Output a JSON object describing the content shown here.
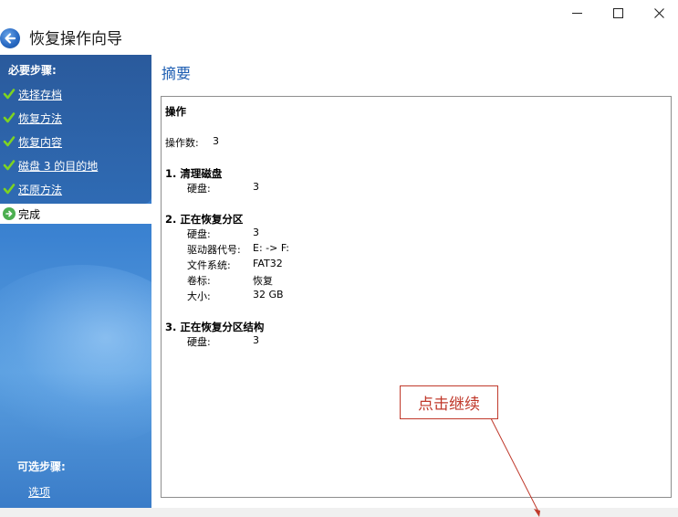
{
  "window": {
    "title": "恢复操作向导"
  },
  "sidebar": {
    "required_heading": "必要步骤:",
    "steps": [
      {
        "label": "选择存档",
        "status": "done"
      },
      {
        "label": "恢复方法",
        "status": "done"
      },
      {
        "label": "恢复内容",
        "status": "done"
      },
      {
        "label": " 磁盘 3 的目的地",
        "status": "done"
      },
      {
        "label": "还原方法",
        "status": "done"
      }
    ],
    "current_step": {
      "label": "完成",
      "status": "current"
    },
    "optional_heading": "可选步骤:",
    "optional_items": [
      {
        "label": "选项"
      }
    ]
  },
  "main": {
    "heading": "摘要",
    "summary": {
      "section_title": "操作",
      "op_count_label": "操作数:",
      "op_count_value": "3",
      "operations": [
        {
          "title": "1. 清理磁盘",
          "rows": [
            {
              "key": "硬盘:",
              "value": "3"
            }
          ]
        },
        {
          "title": "2. 正在恢复分区",
          "rows": [
            {
              "key": "硬盘:",
              "value": "3"
            },
            {
              "key": "驱动器代号:",
              "value": "E: -> F:"
            },
            {
              "key": "文件系统:",
              "value": "FAT32"
            },
            {
              "key": "卷标:",
              "value": "恢复"
            },
            {
              "key": "大小:",
              "value": "32 GB"
            }
          ]
        },
        {
          "title": "3. 正在恢复分区结构",
          "rows": [
            {
              "key": "硬盘:",
              "value": "3"
            }
          ]
        }
      ]
    }
  },
  "annotation": {
    "callout_text": "点击继续",
    "color": "#c0392b"
  },
  "colors": {
    "accent": "#1f5fb3",
    "sidebar": "#2f6fbf",
    "check": "#7ed321"
  }
}
